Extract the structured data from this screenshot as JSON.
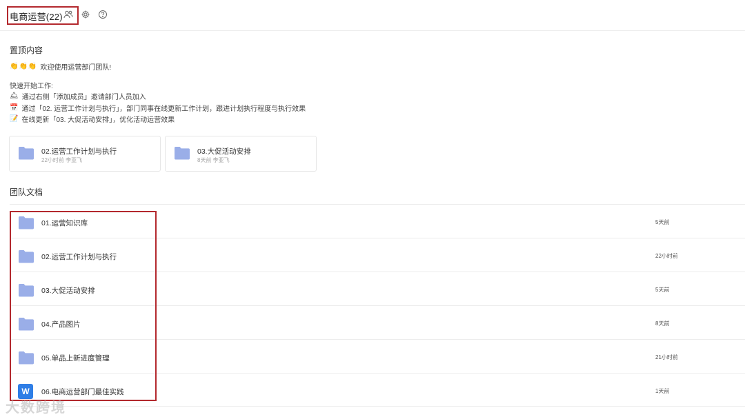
{
  "header": {
    "team_title": "电商运营(22)",
    "icons": [
      "members-icon",
      "gear-icon",
      "help-icon"
    ]
  },
  "pinned": {
    "section_title": "置顶内容",
    "welcome": "欢迎使用运营部门团队!",
    "quick_start_title": "快速开始工作:",
    "tips": [
      "通过右侧「添加成员」邀请部门人员加入",
      "通过「02. 运营工作计划与执行」，部门同事在线更新工作计划，跟进计划执行程度与执行效果",
      "在线更新「03. 大促活动安排」，优化活动运营效果"
    ],
    "cards": [
      {
        "name": "02.运营工作计划与执行",
        "meta": "22小时前 李亚飞"
      },
      {
        "name": "03.大促活动安排",
        "meta": "8天前 李亚飞"
      }
    ]
  },
  "team_docs": {
    "section_title": "团队文档",
    "items": [
      {
        "name": "01.运营知识库",
        "time": "5天前",
        "type": "folder"
      },
      {
        "name": "02.运营工作计划与执行",
        "time": "22小时前",
        "type": "folder"
      },
      {
        "name": "03.大促活动安排",
        "time": "5天前",
        "type": "folder"
      },
      {
        "name": "04.产品图片",
        "time": "8天前",
        "type": "folder"
      },
      {
        "name": "05.单品上新进度管理",
        "time": "21小时前",
        "type": "folder"
      },
      {
        "name": "06.电商运营部门最佳实践",
        "time": "1天前",
        "type": "word"
      }
    ]
  },
  "word_icon_letter": "W",
  "watermark": "大数跨境",
  "colors": {
    "folder": "#9aaee8",
    "highlight_border": "#b3282d",
    "word_blue": "#2f7ee6"
  }
}
